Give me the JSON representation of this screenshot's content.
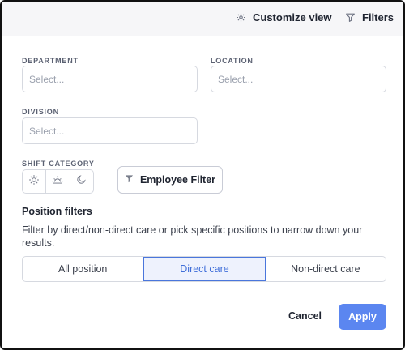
{
  "toolbar": {
    "customize_label": "Customize view",
    "filters_label": "Filters"
  },
  "form": {
    "department": {
      "label": "DEPARTMENT",
      "placeholder": "Select..."
    },
    "location": {
      "label": "LOCATION",
      "placeholder": "Select..."
    },
    "division": {
      "label": "DIVISION",
      "placeholder": "Select..."
    },
    "shift_category": {
      "label": "SHIFT CATEGORY",
      "options": [
        "sun-icon",
        "sunrise-icon",
        "moon-icon"
      ]
    },
    "employee_filter_label": "Employee Filter"
  },
  "position_filters": {
    "title": "Position filters",
    "description": "Filter by direct/non-direct care or pick specific positions to narrow down your results.",
    "options": [
      "All position",
      "Direct care",
      "Non-direct care"
    ],
    "selected": "Direct care"
  },
  "actions": {
    "cancel_label": "Cancel",
    "apply_label": "Apply"
  },
  "colors": {
    "accent": "#5b86f0",
    "selected_text": "#3f6ed9",
    "selected_bg": "#eef2fd"
  }
}
